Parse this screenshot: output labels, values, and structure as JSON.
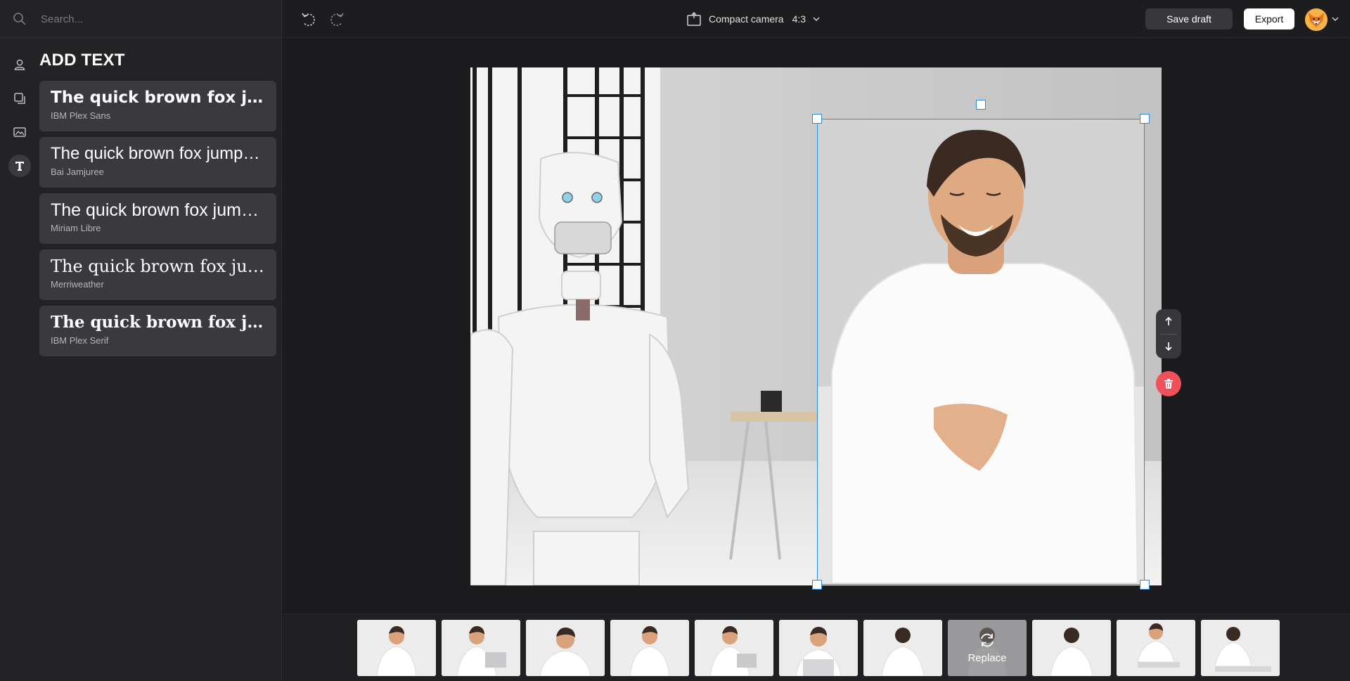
{
  "search": {
    "placeholder": "Search..."
  },
  "sidebar": {
    "rail": [
      {
        "name": "user-icon"
      },
      {
        "name": "layers-icon"
      },
      {
        "name": "image-icon"
      },
      {
        "name": "text-icon",
        "active": true
      }
    ],
    "panel_title": "ADD TEXT",
    "fonts": [
      {
        "sample": "The quick brown fox jumps over the lazy dog",
        "font_name": "IBM Plex Sans"
      },
      {
        "sample": "The quick brown fox jumps over the lazy dog",
        "font_name": "Bai Jamjuree"
      },
      {
        "sample": "The quick brown fox jumps over the lazy dog",
        "font_name": "Miriam Libre"
      },
      {
        "sample": "The quick brown fox jumps over the lazy dog",
        "font_name": "Merriweather"
      },
      {
        "sample": "The quick brown fox jumps over the lazy dog",
        "font_name": "IBM Plex Serif"
      }
    ]
  },
  "topbar": {
    "format_name": "Compact camera",
    "format_ratio": "4:3",
    "save_draft_label": "Save draft",
    "export_label": "Export"
  },
  "filmstrip": {
    "replace_label": "Replace",
    "thumb_count": 11,
    "hovered_index": 7
  },
  "colors": {
    "selection": "#2f8cd8",
    "delete": "#f0505a",
    "avatar": "#f39a2c"
  }
}
